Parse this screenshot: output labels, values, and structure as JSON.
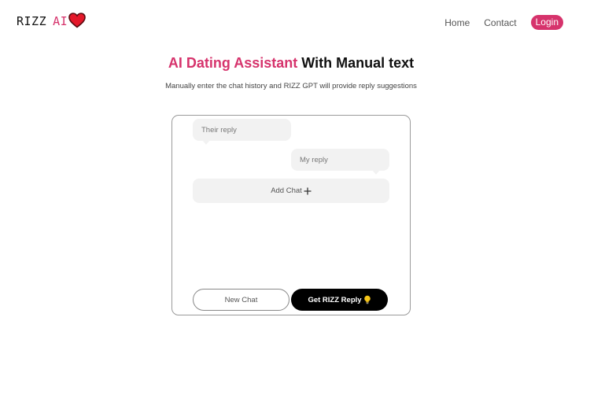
{
  "header": {
    "logo_rizz": "RIZZ",
    "logo_ai": "AI",
    "logo_icon": "heart-icon",
    "nav": {
      "home": "Home",
      "contact": "Contact",
      "login": "Login"
    }
  },
  "hero": {
    "title_accent": "AI Dating Assistant",
    "title_rest": " With Manual text",
    "subtitle": "Manually enter the chat history and RIZZ GPT will provide reply suggestions"
  },
  "chat": {
    "their_reply_placeholder": "Their reply",
    "my_reply_placeholder": "My reply",
    "add_chat_label": "Add Chat",
    "add_icon": "plus-icon"
  },
  "actions": {
    "new_chat_label": "New Chat",
    "get_reply_label": "Get RIZZ Reply",
    "get_reply_icon": "lightbulb-icon"
  },
  "colors": {
    "accent": "#d6336c",
    "heart": "#e4182a",
    "bubble_bg": "#f2f2f2",
    "primary_button": "#000000"
  }
}
